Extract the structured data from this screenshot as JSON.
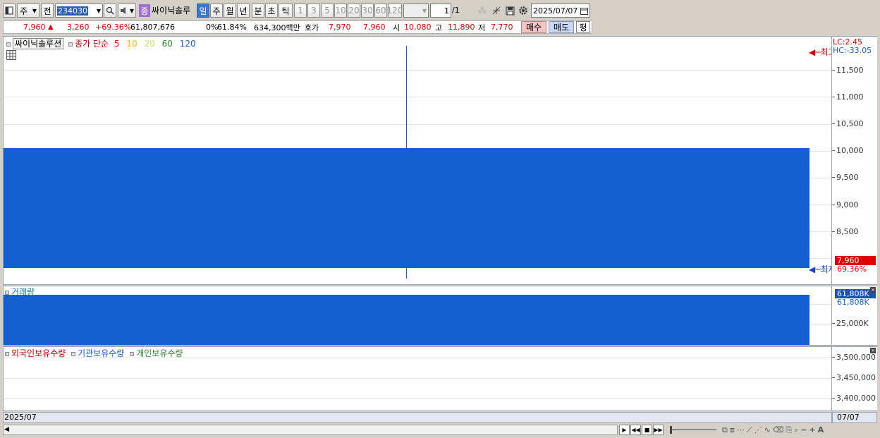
{
  "toolbar": {
    "market": "주",
    "prev_label": "전",
    "code": "234030",
    "type_badge": "종",
    "stock_name": "싸이닉솔루",
    "periods": [
      "일",
      "주",
      "월",
      "년",
      "분",
      "초",
      "틱"
    ],
    "minutes": [
      "1",
      "3",
      "5",
      "10",
      "20",
      "30",
      "60",
      "120"
    ],
    "count_value": "1",
    "count_total": "/1",
    "date": "2025/07/07"
  },
  "quote": {
    "price": "7,960",
    "arrow": "▲",
    "change": "3,260",
    "change_pct": "+69.36%",
    "volume": "61,807,676",
    "zero_pct": "0%",
    "turnover_pct": "61.84%",
    "amount": "634,300백만",
    "hoga_label": "호가",
    "hoga_ask": "7,970",
    "hoga_bid": "7,960",
    "open_label": "시",
    "open": "10,080",
    "high_label": "고",
    "high": "11,890",
    "low_label": "저",
    "low": "7,770",
    "buy_label": "매수",
    "sell_label": "매도",
    "avg_label": "평"
  },
  "price_pane": {
    "title": "싸이닉솔루션",
    "ma_label": "종가 단순",
    "ma_periods": [
      "5",
      "10",
      "20",
      "60",
      "120"
    ],
    "ma_colors": [
      "#e00000",
      "#e8c000",
      "#c8e060",
      "#2a8a2a",
      "#1a5fd0"
    ],
    "max_label": "최고",
    "min_label": "최저",
    "lc_label": "LC:2.45",
    "hc_label": "HC:-33.05",
    "current_price_label": "7,960",
    "current_pct_label": "69.36%",
    "ticks": [
      "11,500",
      "11,000",
      "10,500",
      "10,000",
      "9,500",
      "9,000",
      "8,500"
    ],
    "candle": {
      "open": 10080,
      "high": 11890,
      "low": 7770,
      "close": 7960
    },
    "scale": {
      "min": 7650,
      "max": 12050
    },
    "candle_color": "#1560d0"
  },
  "volume_pane": {
    "title": "거래량",
    "value_label": "61,808K",
    "value_label2": "61,808K",
    "tick": "25,000K",
    "value_k": 61808,
    "max_k": 62000
  },
  "holding_pane": {
    "legends": [
      {
        "label": "외국인보유수량",
        "color": "#c00000"
      },
      {
        "label": "기관보유수량",
        "color": "#1a5fd0"
      },
      {
        "label": "개인보유수량",
        "color": "#2a8a2a"
      }
    ],
    "ticks": [
      "3,500,000",
      "3,450,000",
      "3,400,000"
    ]
  },
  "xaxis": {
    "left_label": "2025/07",
    "right_label": "07/07"
  },
  "icons": {
    "chart_type": "chart-type-icon",
    "search": "search-icon",
    "sound": "speaker-icon",
    "settings": "gear-icon",
    "save": "save-icon",
    "calendar": "calendar-icon"
  }
}
